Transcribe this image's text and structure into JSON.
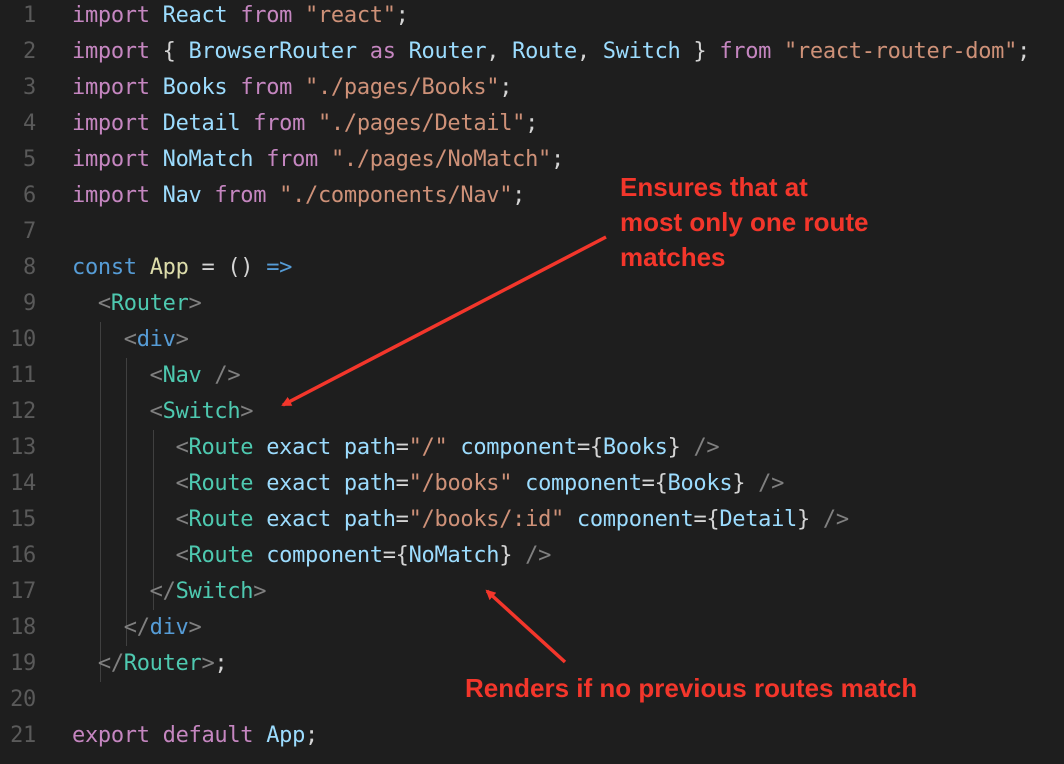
{
  "colors": {
    "background": "#1e1e1e",
    "line_number": "#5a5a5a",
    "keyword": "#c586c0",
    "storage": "#569cd6",
    "identifier": "#9cdcfe",
    "string": "#ce9178",
    "tag": "#4ec9b0",
    "bracket": "#808080",
    "function": "#dcdcaa",
    "text": "#d4d4d4",
    "annotation": "#f3362b"
  },
  "code_lines": [
    {
      "number": "1",
      "tokens": [
        [
          "import",
          "keyword"
        ],
        [
          " ",
          "text"
        ],
        [
          "React",
          "identifier"
        ],
        [
          " ",
          "text"
        ],
        [
          "from",
          "keyword"
        ],
        [
          " ",
          "text"
        ],
        [
          "\"react\"",
          "string"
        ],
        [
          ";",
          "text"
        ]
      ]
    },
    {
      "number": "2",
      "tokens": [
        [
          "import",
          "keyword"
        ],
        [
          " { ",
          "text"
        ],
        [
          "BrowserRouter",
          "identifier"
        ],
        [
          " ",
          "text"
        ],
        [
          "as",
          "keyword"
        ],
        [
          " ",
          "text"
        ],
        [
          "Router",
          "identifier"
        ],
        [
          ", ",
          "text"
        ],
        [
          "Route",
          "identifier"
        ],
        [
          ", ",
          "text"
        ],
        [
          "Switch",
          "identifier"
        ],
        [
          " } ",
          "text"
        ],
        [
          "from",
          "keyword"
        ],
        [
          " ",
          "text"
        ],
        [
          "\"react-router-dom\"",
          "string"
        ],
        [
          ";",
          "text"
        ]
      ]
    },
    {
      "number": "3",
      "tokens": [
        [
          "import",
          "keyword"
        ],
        [
          " ",
          "text"
        ],
        [
          "Books",
          "identifier"
        ],
        [
          " ",
          "text"
        ],
        [
          "from",
          "keyword"
        ],
        [
          " ",
          "text"
        ],
        [
          "\"./pages/Books\"",
          "string"
        ],
        [
          ";",
          "text"
        ]
      ]
    },
    {
      "number": "4",
      "tokens": [
        [
          "import",
          "keyword"
        ],
        [
          " ",
          "text"
        ],
        [
          "Detail",
          "identifier"
        ],
        [
          " ",
          "text"
        ],
        [
          "from",
          "keyword"
        ],
        [
          " ",
          "text"
        ],
        [
          "\"./pages/Detail\"",
          "string"
        ],
        [
          ";",
          "text"
        ]
      ]
    },
    {
      "number": "5",
      "tokens": [
        [
          "import",
          "keyword"
        ],
        [
          " ",
          "text"
        ],
        [
          "NoMatch",
          "identifier"
        ],
        [
          " ",
          "text"
        ],
        [
          "from",
          "keyword"
        ],
        [
          " ",
          "text"
        ],
        [
          "\"./pages/NoMatch\"",
          "string"
        ],
        [
          ";",
          "text"
        ]
      ]
    },
    {
      "number": "6",
      "tokens": [
        [
          "import",
          "keyword"
        ],
        [
          " ",
          "text"
        ],
        [
          "Nav",
          "identifier"
        ],
        [
          " ",
          "text"
        ],
        [
          "from",
          "keyword"
        ],
        [
          " ",
          "text"
        ],
        [
          "\"./components/Nav\"",
          "string"
        ],
        [
          ";",
          "text"
        ]
      ]
    },
    {
      "number": "7",
      "tokens": []
    },
    {
      "number": "8",
      "tokens": [
        [
          "const",
          "storage"
        ],
        [
          " ",
          "text"
        ],
        [
          "App",
          "function"
        ],
        [
          " = () ",
          "text"
        ],
        [
          "=>",
          "storage"
        ]
      ]
    },
    {
      "number": "9",
      "tokens": [
        [
          "  ",
          "text"
        ],
        [
          "<",
          "bracket"
        ],
        [
          "Router",
          "tag"
        ],
        [
          ">",
          "bracket"
        ]
      ]
    },
    {
      "number": "10",
      "tokens": [
        [
          "    ",
          "text"
        ],
        [
          "<",
          "bracket"
        ],
        [
          "div",
          "storage"
        ],
        [
          ">",
          "bracket"
        ]
      ]
    },
    {
      "number": "11",
      "tokens": [
        [
          "      ",
          "text"
        ],
        [
          "<",
          "bracket"
        ],
        [
          "Nav",
          "tag"
        ],
        [
          " />",
          "bracket"
        ]
      ]
    },
    {
      "number": "12",
      "tokens": [
        [
          "      ",
          "text"
        ],
        [
          "<",
          "bracket"
        ],
        [
          "Switch",
          "tag"
        ],
        [
          ">",
          "bracket"
        ]
      ]
    },
    {
      "number": "13",
      "tokens": [
        [
          "        ",
          "text"
        ],
        [
          "<",
          "bracket"
        ],
        [
          "Route",
          "tag"
        ],
        [
          " ",
          "text"
        ],
        [
          "exact",
          "identifier"
        ],
        [
          " ",
          "text"
        ],
        [
          "path",
          "identifier"
        ],
        [
          "=",
          "text"
        ],
        [
          "\"/\"",
          "string"
        ],
        [
          " ",
          "text"
        ],
        [
          "component",
          "identifier"
        ],
        [
          "={",
          "text"
        ],
        [
          "Books",
          "identifier"
        ],
        [
          "}",
          "text"
        ],
        [
          " />",
          "bracket"
        ]
      ]
    },
    {
      "number": "14",
      "tokens": [
        [
          "        ",
          "text"
        ],
        [
          "<",
          "bracket"
        ],
        [
          "Route",
          "tag"
        ],
        [
          " ",
          "text"
        ],
        [
          "exact",
          "identifier"
        ],
        [
          " ",
          "text"
        ],
        [
          "path",
          "identifier"
        ],
        [
          "=",
          "text"
        ],
        [
          "\"/books\"",
          "string"
        ],
        [
          " ",
          "text"
        ],
        [
          "component",
          "identifier"
        ],
        [
          "={",
          "text"
        ],
        [
          "Books",
          "identifier"
        ],
        [
          "}",
          "text"
        ],
        [
          " />",
          "bracket"
        ]
      ]
    },
    {
      "number": "15",
      "tokens": [
        [
          "        ",
          "text"
        ],
        [
          "<",
          "bracket"
        ],
        [
          "Route",
          "tag"
        ],
        [
          " ",
          "text"
        ],
        [
          "exact",
          "identifier"
        ],
        [
          " ",
          "text"
        ],
        [
          "path",
          "identifier"
        ],
        [
          "=",
          "text"
        ],
        [
          "\"/books/:id\"",
          "string"
        ],
        [
          " ",
          "text"
        ],
        [
          "component",
          "identifier"
        ],
        [
          "={",
          "text"
        ],
        [
          "Detail",
          "identifier"
        ],
        [
          "}",
          "text"
        ],
        [
          " />",
          "bracket"
        ]
      ]
    },
    {
      "number": "16",
      "tokens": [
        [
          "        ",
          "text"
        ],
        [
          "<",
          "bracket"
        ],
        [
          "Route",
          "tag"
        ],
        [
          " ",
          "text"
        ],
        [
          "component",
          "identifier"
        ],
        [
          "={",
          "text"
        ],
        [
          "NoMatch",
          "identifier"
        ],
        [
          "}",
          "text"
        ],
        [
          " />",
          "bracket"
        ]
      ]
    },
    {
      "number": "17",
      "tokens": [
        [
          "      ",
          "text"
        ],
        [
          "</",
          "bracket"
        ],
        [
          "Switch",
          "tag"
        ],
        [
          ">",
          "bracket"
        ]
      ]
    },
    {
      "number": "18",
      "tokens": [
        [
          "    ",
          "text"
        ],
        [
          "</",
          "bracket"
        ],
        [
          "div",
          "storage"
        ],
        [
          ">",
          "bracket"
        ]
      ]
    },
    {
      "number": "19",
      "tokens": [
        [
          "  ",
          "text"
        ],
        [
          "</",
          "bracket"
        ],
        [
          "Router",
          "tag"
        ],
        [
          ">",
          "bracket"
        ],
        [
          ";",
          "text"
        ]
      ]
    },
    {
      "number": "20",
      "tokens": []
    },
    {
      "number": "21",
      "tokens": [
        [
          "export",
          "keyword"
        ],
        [
          " ",
          "text"
        ],
        [
          "default",
          "keyword"
        ],
        [
          " ",
          "text"
        ],
        [
          "App",
          "identifier"
        ],
        [
          ";",
          "text"
        ]
      ]
    }
  ],
  "annotations": {
    "switch_note": "Ensures that at\nmost only one route\nmatches",
    "nomatch_note": "Renders if no previous routes match"
  }
}
